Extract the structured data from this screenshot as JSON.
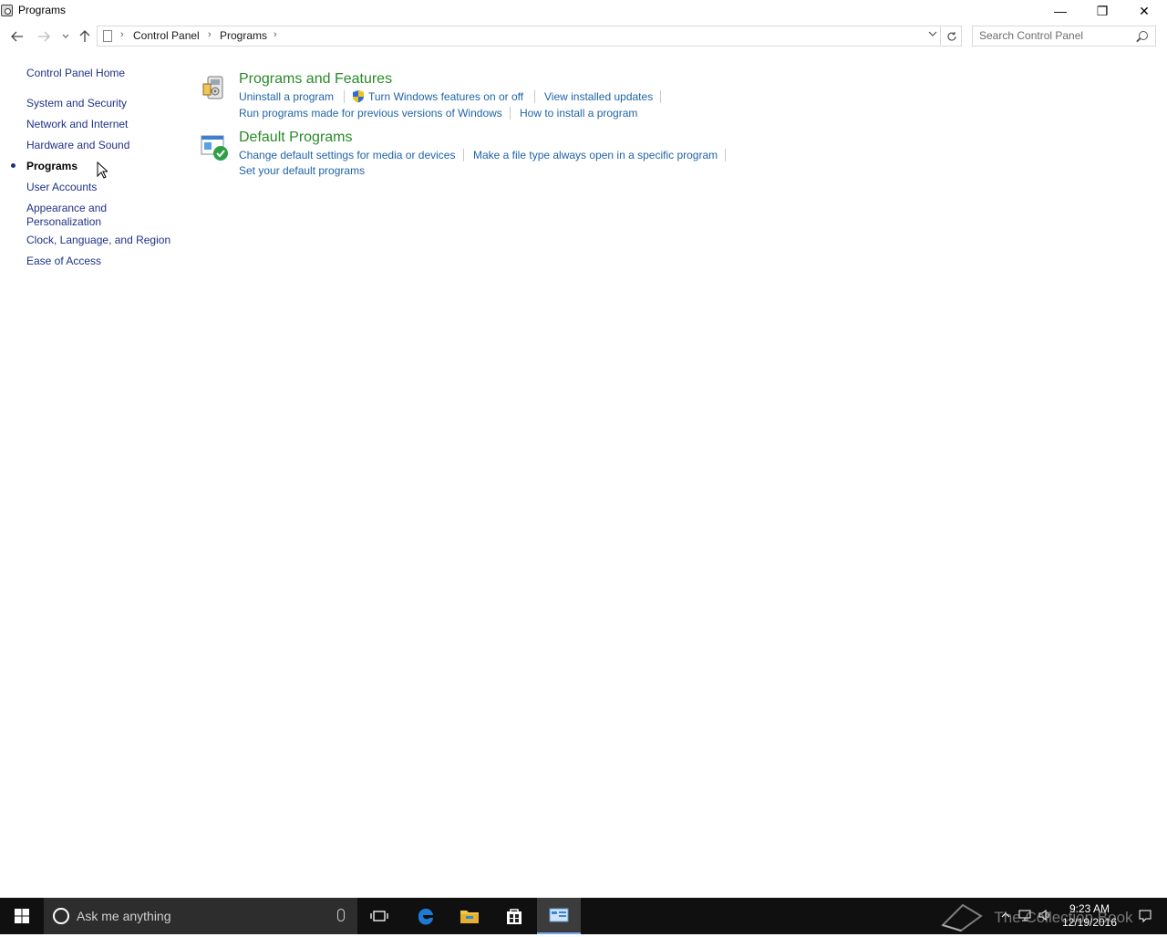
{
  "window": {
    "title": "Programs",
    "minimize_glyph": "—",
    "maximize_glyph": "❐",
    "close_glyph": "✕"
  },
  "address": {
    "crumbs": [
      "Control Panel",
      "Programs"
    ],
    "separator": "›"
  },
  "search": {
    "placeholder": "Search Control Panel"
  },
  "sidebar": {
    "home": "Control Panel Home",
    "items": [
      {
        "label": "System and Security",
        "active": false
      },
      {
        "label": "Network and Internet",
        "active": false
      },
      {
        "label": "Hardware and Sound",
        "active": false
      },
      {
        "label": "Programs",
        "active": true
      },
      {
        "label": "User Accounts",
        "active": false
      },
      {
        "label": "Appearance and",
        "label2": "Personalization",
        "active": false
      },
      {
        "label": "Clock, Language, and Region",
        "active": false
      },
      {
        "label": "Ease of Access",
        "active": false
      }
    ]
  },
  "sections": {
    "programs_features": {
      "title": "Programs and Features",
      "links": [
        "Uninstall a program",
        "Turn Windows features on or off",
        "View installed updates",
        "Run programs made for previous versions of Windows",
        "How to install a program"
      ]
    },
    "default_programs": {
      "title": "Default Programs",
      "links": [
        "Change default settings for media or devices",
        "Make a file type always open in a specific program",
        "Set your default programs"
      ]
    }
  },
  "taskbar": {
    "search_text": "Ask me anything",
    "time": "9:23 AM",
    "date": "12/19/2016",
    "watermark": "The Collection Book"
  },
  "colors": {
    "link": "#1e64a8",
    "section_title": "#2a8a2a",
    "taskbar": "#101010"
  }
}
